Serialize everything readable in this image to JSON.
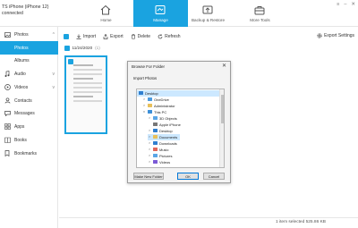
{
  "device": {
    "name": "TS iPhone (iPhone 12)",
    "status": "connected"
  },
  "nav": [
    {
      "label": "Home",
      "icon": "home-icon",
      "active": false
    },
    {
      "label": "Manage",
      "icon": "manage-icon",
      "active": true
    },
    {
      "label": "Backup & Restore",
      "icon": "backup-restore-icon",
      "active": false
    },
    {
      "label": "More Tools",
      "icon": "toolbox-icon",
      "active": false
    }
  ],
  "window_controls": {
    "menu": "≡",
    "minimize": "–",
    "close": "✕"
  },
  "sidebar": {
    "photos": "Photos",
    "photos_sub": "Photos",
    "albums": "Albums",
    "audio": "Audio",
    "videos": "Videos",
    "contacts": "Contacts",
    "messages": "Messages",
    "apps": "Apps",
    "books": "Books",
    "bookmarks": "Bookmarks"
  },
  "toolbar": {
    "import": "Import",
    "export": "Export",
    "delete": "Delete",
    "refresh": "Refresh",
    "settings": "Export Settings"
  },
  "date_group": {
    "date": "11/24/2020",
    "count": "(1)"
  },
  "dialog": {
    "title": "Browse For Folder",
    "close": "✕",
    "subtitle": "Import Photos",
    "tree": {
      "desktop": "Desktop",
      "onedrive": "OneDrive",
      "administrator": "Administrator",
      "thispc": "This PC",
      "objects3d": "3D Objects",
      "apple_iphone": "Apple iPhone",
      "desktop2": "Desktop",
      "documents": "Documents",
      "downloads": "Downloads",
      "music": "Music",
      "pictures": "Pictures",
      "videos": "Videos"
    },
    "buttons": {
      "new_folder": "Make New Folder",
      "ok": "OK",
      "cancel": "Cancel"
    }
  },
  "status": {
    "text": "1 item selected 525.86 KB"
  },
  "colors": {
    "accent": "#1aa3e0",
    "tree_selection": "#cce8ff"
  }
}
